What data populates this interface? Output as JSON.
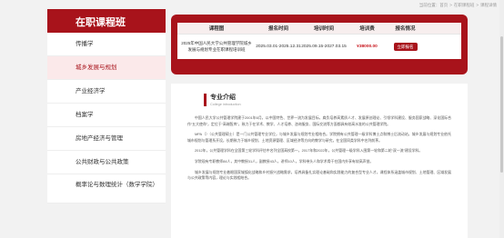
{
  "breadcrumb": [
    "当前位置：",
    "首页",
    "在职课程班",
    "课程详情"
  ],
  "sidebar": {
    "title": "在职课程班",
    "items": [
      {
        "label": "传播学",
        "active": false
      },
      {
        "label": "城乡发展与规划",
        "active": true
      },
      {
        "label": "产业经济学",
        "active": false
      },
      {
        "label": "档案学",
        "active": false
      },
      {
        "label": "房地产经济与管理",
        "active": false
      },
      {
        "label": "公共财政与公共政策",
        "active": false
      },
      {
        "label": "概率论与数理统计（数学学院）",
        "active": false
      }
    ]
  },
  "course_table": {
    "headers": [
      "课程图",
      "报名时间",
      "培训时间",
      "培训费",
      "报名情况"
    ],
    "rows": [
      {
        "name": "2025年中国人民大学公共管理学院城乡发展与规划专业在职课程培训班",
        "enroll_time": "2025.03.01-2025.12.31",
        "train_time": "2025.09.15-2027.03.15",
        "fee": "¥38000.00",
        "action": "立即报名"
      }
    ]
  },
  "intro": {
    "title": "专业介绍",
    "subtitle": "College introduction",
    "paragraphs": [
      "中国人民大学公共管理学院建于2001年6月，以中国特色、世界一流为发展目标，肩负培养高素质人才、发展原创理论、引领学科建设、服务国家战略、深化国际合作“五大使命”，定位于“高端智库”，致力于在学术、教学、人才培养、咨询服务、国际交流等方面都具有较高水准的公共管理学院。",
      "MPA（）（公共管理硕士）是一门公共管理专业学位，与城乡发展与规划专业相结合。学院拥有公共管理一级学科博士点和博士后流动站，城乡发展与规划专业依托城市规划与管理系开设，长期致力于城乡规划、土地资源管理、区域经济等方向的教学与研究，在全国同类学科中名列前茅。",
      "2012年，公共管理学科在全国第三轮学科评估中名列全国高校第一，2017年和2022年，公共管理一级学科入围第一轮和第二轮“双一流”建设学科。",
      "学院现有专职教师84人，其中教授31人，副教授43人，讲师10人，学科带头人和学术骨干在国内外享有较高声誉。",
      "城乡发展与规划专业着眼国家城镇化战略和乡村振兴战略需求，培养具备扎实理论基础和实践能力的复合型专业人才，课程体系涵盖城市规划、土地管理、区域发展与公共政策等内容，理论与实践相结合。"
    ]
  }
}
